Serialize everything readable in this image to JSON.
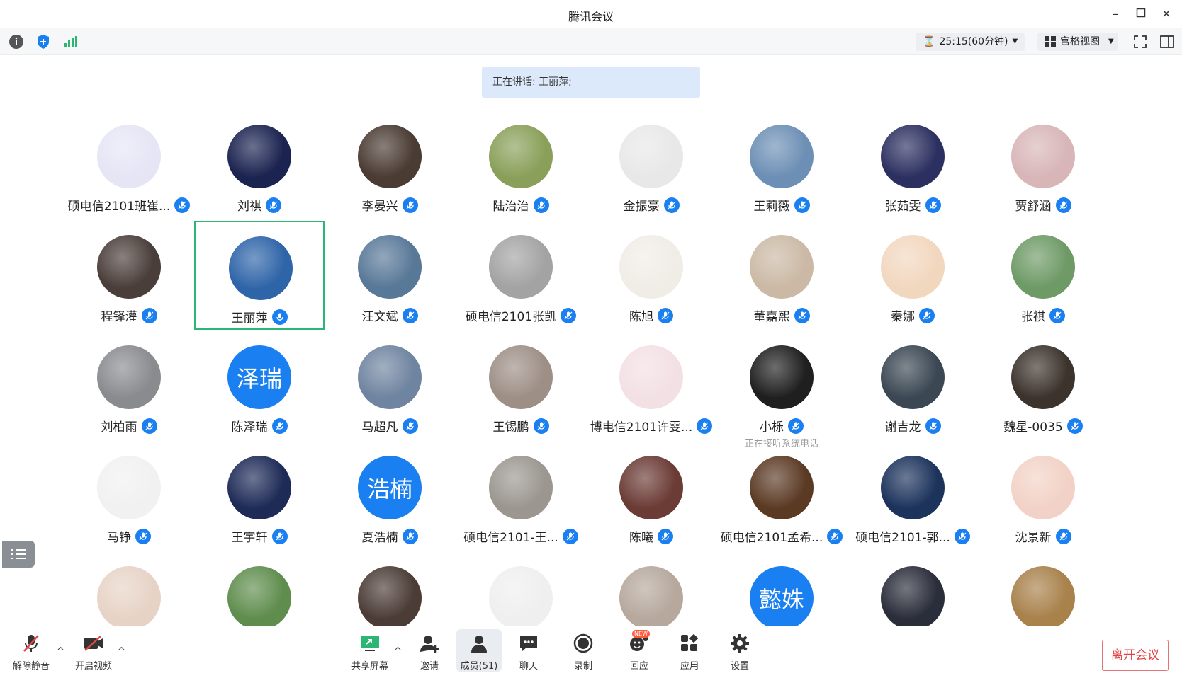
{
  "window": {
    "title": "腾讯会议"
  },
  "toolbar": {
    "timer": "25:15(60分钟)",
    "view_label": "宫格视图"
  },
  "speaking": {
    "text": "正在讲话: 王丽萍;"
  },
  "participants": [
    {
      "name": "硕电信2101班崔...",
      "avatar": "bear-cloud-avatar",
      "bg": "#e6e5f5"
    },
    {
      "name": "刘祺",
      "avatar": "moon-avatar",
      "bg": "#1b2350"
    },
    {
      "name": "李晏兴",
      "avatar": "child-window-avatar",
      "bg": "#4a3b33"
    },
    {
      "name": "陆治治",
      "avatar": "kid-sunglasses-avatar",
      "bg": "#8aa05a"
    },
    {
      "name": "金振豪",
      "avatar": "cartoon-mouse-avatar",
      "bg": "#e8e8e8"
    },
    {
      "name": "王莉薇",
      "avatar": "mountain-clouds-avatar",
      "bg": "#6d8fb5"
    },
    {
      "name": "张茹雯",
      "avatar": "dog-avatar",
      "bg": "#2c3060"
    },
    {
      "name": "贾舒涵",
      "avatar": "flowers-child-avatar",
      "bg": "#d8b6b8"
    },
    {
      "name": "程铎灌",
      "avatar": "pebbles-avatar",
      "bg": "#4a3e3a"
    },
    {
      "name": "王丽萍",
      "avatar": "heart-cloud-avatar",
      "bg": "#2e64a8"
    },
    {
      "name": "汪文斌",
      "avatar": "lake-avatar",
      "bg": "#587898"
    },
    {
      "name": "硕电信2101张凯",
      "avatar": "fog-avatar",
      "bg": "#a3a3a3"
    },
    {
      "name": "陈旭",
      "avatar": "cat-meme-avatar",
      "bg": "#f0ede7"
    },
    {
      "name": "董嘉熙",
      "avatar": "bowl-avatar",
      "bg": "#cbb9a5"
    },
    {
      "name": "秦娜",
      "avatar": "anime-girl-avatar",
      "bg": "#f2d7bf"
    },
    {
      "name": "张祺",
      "avatar": "lotus-avatar",
      "bg": "#6e9a66"
    },
    {
      "name": "刘柏雨",
      "avatar": "ultraman-avatar",
      "bg": "#8a8b8f"
    },
    {
      "name": "陈泽瑞",
      "avatar_text": "泽瑞"
    },
    {
      "name": "马超凡",
      "avatar": "sea-avatar",
      "bg": "#6f84a0"
    },
    {
      "name": "王锡鹏",
      "avatar": "cat-avatar",
      "bg": "#9d8f86"
    },
    {
      "name": "博电信2101许雯...",
      "avatar": "anime-blonde-avatar",
      "bg": "#f3e0e4"
    },
    {
      "name": "小栎",
      "avatar": "phone-avatar",
      "bg": "#1f1f1f",
      "status": "正在接听系统电话"
    },
    {
      "name": "谢吉龙",
      "avatar": "forest-avatar",
      "bg": "#3b4753"
    },
    {
      "name": "魏星-0035",
      "avatar": "boy-avatar",
      "bg": "#3c332c"
    },
    {
      "name": "马铮",
      "avatar": "pixel-face-avatar",
      "bg": "#f1f1f1"
    },
    {
      "name": "王宇轩",
      "avatar": "anime-fire-avatar",
      "bg": "#1e2b57"
    },
    {
      "name": "夏浩楠",
      "avatar_text": "浩楠"
    },
    {
      "name": "硕电信2101-王...",
      "avatar": "shelf-avatar",
      "bg": "#9b9690"
    },
    {
      "name": "陈曦",
      "avatar": "room-avatar",
      "bg": "#6b3b35"
    },
    {
      "name": "硕电信2101孟希...",
      "avatar": "actor-avatar",
      "bg": "#5b3a24"
    },
    {
      "name": "硕电信2101-郭...",
      "avatar": "moon-figure-avatar",
      "bg": "#1c335c"
    },
    {
      "name": "沈景新",
      "avatar": "anime-scarf-avatar",
      "bg": "#f2d2c6"
    },
    {
      "name": "",
      "avatar": "anime-group-avatar",
      "bg": "#e7d3c6"
    },
    {
      "name": "",
      "avatar": "naruto-avatar",
      "bg": "#5f8d4d"
    },
    {
      "name": "",
      "avatar": "smiling-boy-avatar",
      "bg": "#4b3c36"
    },
    {
      "name": "",
      "avatar": "sketch-cat-avatar",
      "bg": "#efefef"
    },
    {
      "name": "",
      "avatar": "hat-avatar",
      "bg": "#b6a89d"
    },
    {
      "name": "",
      "avatar_text": "懿姝"
    },
    {
      "name": "",
      "avatar": "dark-cat-avatar",
      "bg": "#2a2d3a"
    },
    {
      "name": "",
      "avatar": "tiger-avatar",
      "bg": "#a8814b"
    }
  ],
  "bottombar": {
    "unmute": "解除静音",
    "start_video": "开启视频",
    "share_screen": "共享屏幕",
    "invite": "邀请",
    "members": "成员(51)",
    "chat": "聊天",
    "record": "录制",
    "reply": "回应",
    "apps": "应用",
    "settings": "设置",
    "leave": "离开会议",
    "new_badge": "NEW"
  }
}
